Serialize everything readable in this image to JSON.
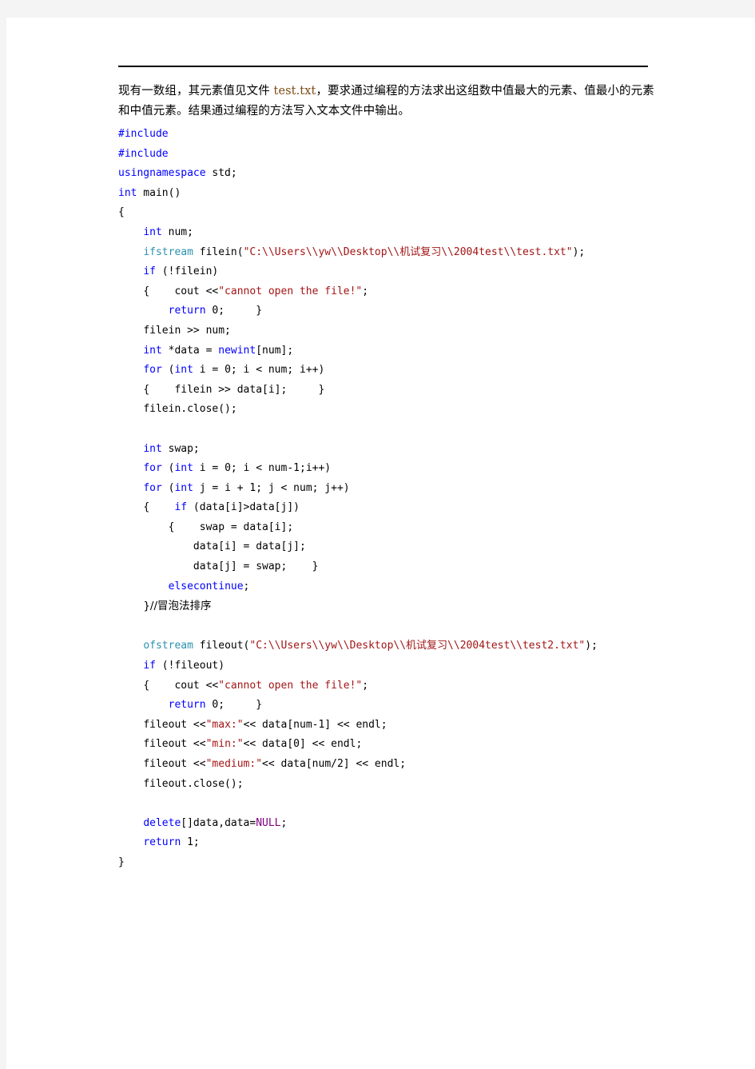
{
  "document": {
    "prose": {
      "line1_pre": "现有一数组，其元素值见文件 ",
      "filename": "test.txt",
      "line1_post": "，要求通过编程的方法求出这组数中值最大的元素、值最小的元素和中值元素。结果通过编程的方法写入文本文件中输出。"
    },
    "code": {
      "language": "cpp",
      "lines": [
        {
          "indent": 0,
          "tokens": [
            {
              "t": "#include",
              "c": "mac"
            }
          ]
        },
        {
          "indent": 0,
          "tokens": [
            {
              "t": "#include",
              "c": "mac"
            }
          ]
        },
        {
          "indent": 0,
          "tokens": [
            {
              "t": "usingnamespace",
              "c": "kw"
            },
            {
              "t": " std;",
              "c": "plain"
            }
          ]
        },
        {
          "indent": 0,
          "tokens": [
            {
              "t": "int",
              "c": "kw"
            },
            {
              "t": " main()",
              "c": "plain"
            }
          ]
        },
        {
          "indent": 0,
          "tokens": [
            {
              "t": "{",
              "c": "plain"
            }
          ]
        },
        {
          "indent": 1,
          "tokens": [
            {
              "t": "int",
              "c": "kw"
            },
            {
              "t": " num;",
              "c": "plain"
            }
          ]
        },
        {
          "indent": 1,
          "tokens": [
            {
              "t": "ifstream",
              "c": "typ"
            },
            {
              "t": " filein(",
              "c": "plain"
            },
            {
              "t": "\"C:\\\\Users\\\\yw\\\\Desktop\\\\机试复习\\\\2004test\\\\test.txt\"",
              "c": "str"
            },
            {
              "t": ");",
              "c": "plain"
            }
          ]
        },
        {
          "indent": 1,
          "tokens": [
            {
              "t": "if",
              "c": "kw"
            },
            {
              "t": " (!filein)",
              "c": "plain"
            }
          ]
        },
        {
          "indent": 1,
          "tokens": [
            {
              "t": "{    cout <<",
              "c": "plain"
            },
            {
              "t": "\"cannot open the file!\"",
              "c": "str"
            },
            {
              "t": ";",
              "c": "plain"
            }
          ]
        },
        {
          "indent": 2,
          "tokens": [
            {
              "t": "return",
              "c": "kw"
            },
            {
              "t": " 0;     }",
              "c": "plain"
            }
          ]
        },
        {
          "indent": 1,
          "tokens": [
            {
              "t": "filein >> num;",
              "c": "plain"
            }
          ]
        },
        {
          "indent": 1,
          "tokens": [
            {
              "t": "int",
              "c": "kw"
            },
            {
              "t": " *data = ",
              "c": "plain"
            },
            {
              "t": "newint",
              "c": "kw"
            },
            {
              "t": "[num];",
              "c": "plain"
            }
          ]
        },
        {
          "indent": 1,
          "tokens": [
            {
              "t": "for",
              "c": "kw"
            },
            {
              "t": " (",
              "c": "plain"
            },
            {
              "t": "int",
              "c": "kw"
            },
            {
              "t": " i = 0; i < num; i++)",
              "c": "plain"
            }
          ]
        },
        {
          "indent": 1,
          "tokens": [
            {
              "t": "{    filein >> data[i];     }",
              "c": "plain"
            }
          ]
        },
        {
          "indent": 1,
          "tokens": [
            {
              "t": "filein.close();",
              "c": "plain"
            }
          ]
        },
        {
          "indent": 0,
          "tokens": []
        },
        {
          "indent": 1,
          "tokens": [
            {
              "t": "int",
              "c": "kw"
            },
            {
              "t": " swap;",
              "c": "plain"
            }
          ]
        },
        {
          "indent": 1,
          "tokens": [
            {
              "t": "for",
              "c": "kw"
            },
            {
              "t": " (",
              "c": "plain"
            },
            {
              "t": "int",
              "c": "kw"
            },
            {
              "t": " i = 0; i < num-1;i++)",
              "c": "plain"
            }
          ]
        },
        {
          "indent": 1,
          "tokens": [
            {
              "t": "for",
              "c": "kw"
            },
            {
              "t": " (",
              "c": "plain"
            },
            {
              "t": "int",
              "c": "kw"
            },
            {
              "t": " j = i + 1; j < num; j++)",
              "c": "plain"
            }
          ]
        },
        {
          "indent": 1,
          "tokens": [
            {
              "t": "{    ",
              "c": "plain"
            },
            {
              "t": "if",
              "c": "kw"
            },
            {
              "t": " (data[i]>data[j])",
              "c": "plain"
            }
          ]
        },
        {
          "indent": 2,
          "tokens": [
            {
              "t": "{    swap = data[i];",
              "c": "plain"
            }
          ]
        },
        {
          "indent": 3,
          "tokens": [
            {
              "t": "data[i] = data[j];",
              "c": "plain"
            }
          ]
        },
        {
          "indent": 3,
          "tokens": [
            {
              "t": "data[j] = swap;    }",
              "c": "plain"
            }
          ]
        },
        {
          "indent": 2,
          "tokens": [
            {
              "t": "elsecontinue",
              "c": "kw"
            },
            {
              "t": ";",
              "c": "plain"
            }
          ]
        },
        {
          "indent": 1,
          "tokens": [
            {
              "t": "}//冒泡法排序",
              "c": "cmt"
            }
          ]
        },
        {
          "indent": 0,
          "tokens": []
        },
        {
          "indent": 1,
          "tokens": [
            {
              "t": "ofstream",
              "c": "typ"
            },
            {
              "t": " fileout(",
              "c": "plain"
            },
            {
              "t": "\"C:\\\\Users\\\\yw\\\\Desktop\\\\机试复习\\\\2004test\\\\test2.txt\"",
              "c": "str"
            },
            {
              "t": ");",
              "c": "plain"
            }
          ]
        },
        {
          "indent": 1,
          "tokens": [
            {
              "t": "if",
              "c": "kw"
            },
            {
              "t": " (!fileout)",
              "c": "plain"
            }
          ]
        },
        {
          "indent": 1,
          "tokens": [
            {
              "t": "{    cout <<",
              "c": "plain"
            },
            {
              "t": "\"cannot open the file!\"",
              "c": "str"
            },
            {
              "t": ";",
              "c": "plain"
            }
          ]
        },
        {
          "indent": 2,
          "tokens": [
            {
              "t": "return",
              "c": "kw"
            },
            {
              "t": " 0;     }",
              "c": "plain"
            }
          ]
        },
        {
          "indent": 1,
          "tokens": [
            {
              "t": "fileout <<",
              "c": "plain"
            },
            {
              "t": "\"max:\"",
              "c": "str"
            },
            {
              "t": "<< data[num-1] << endl;",
              "c": "plain"
            }
          ]
        },
        {
          "indent": 1,
          "tokens": [
            {
              "t": "fileout <<",
              "c": "plain"
            },
            {
              "t": "\"min:\"",
              "c": "str"
            },
            {
              "t": "<< data[0] << endl;",
              "c": "plain"
            }
          ]
        },
        {
          "indent": 1,
          "tokens": [
            {
              "t": "fileout <<",
              "c": "plain"
            },
            {
              "t": "\"medium:\"",
              "c": "str"
            },
            {
              "t": "<< data[num/2] << endl;",
              "c": "plain"
            }
          ]
        },
        {
          "indent": 1,
          "tokens": [
            {
              "t": "fileout.close();",
              "c": "plain"
            }
          ]
        },
        {
          "indent": 0,
          "tokens": []
        },
        {
          "indent": 1,
          "tokens": [
            {
              "t": "delete",
              "c": "kw"
            },
            {
              "t": "[]data,data=",
              "c": "plain"
            },
            {
              "t": "NULL",
              "c": "nul"
            },
            {
              "t": ";",
              "c": "plain"
            }
          ]
        },
        {
          "indent": 1,
          "tokens": [
            {
              "t": "return",
              "c": "kw"
            },
            {
              "t": " 1;",
              "c": "plain"
            }
          ]
        },
        {
          "indent": 0,
          "tokens": [
            {
              "t": "}",
              "c": "plain"
            }
          ]
        }
      ]
    },
    "colors": {
      "keyword": "#0000ff",
      "type": "#2b91af",
      "string": "#a31515",
      "null_literal": "#800080",
      "text": "#000000",
      "page_surround": "#f4f4f4",
      "rule": "#000000"
    }
  }
}
